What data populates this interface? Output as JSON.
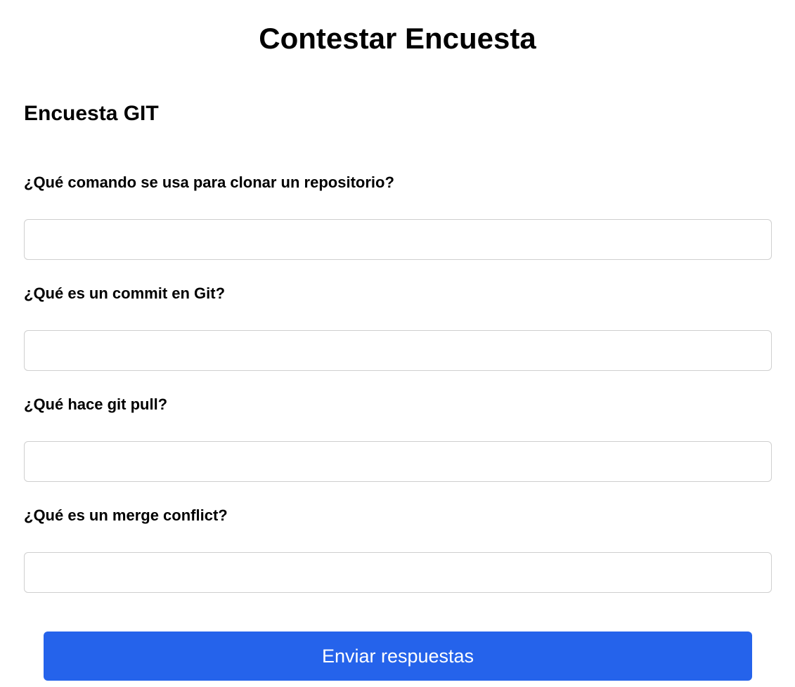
{
  "header": {
    "title": "Contestar Encuesta"
  },
  "survey": {
    "name": "Encuesta GIT",
    "questions": [
      {
        "label": "¿Qué comando se usa para clonar un repositorio?",
        "value": "",
        "placeholder": ""
      },
      {
        "label": "¿Qué es un commit en Git?",
        "value": "",
        "placeholder": ""
      },
      {
        "label": "¿Qué hace git pull?",
        "value": "",
        "placeholder": ""
      },
      {
        "label": "¿Qué es un merge conflict?",
        "value": "",
        "placeholder": ""
      }
    ]
  },
  "actions": {
    "submit_label": "Enviar respuestas"
  },
  "colors": {
    "accent": "#2563eb",
    "input_border": "#cfcfcf",
    "background": "#ffffff"
  }
}
